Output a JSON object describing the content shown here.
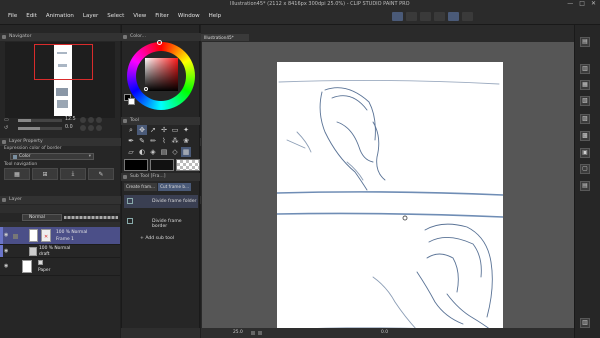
{
  "window": {
    "title": "Illustration45* (2112 x 8416px 300dpi 25.0%) - CLIP STUDIO PAINT PRO",
    "controls": [
      "—",
      "□",
      "✕"
    ]
  },
  "menu": [
    "File",
    "Edit",
    "Animation",
    "Layer",
    "Select",
    "View",
    "Filter",
    "Window",
    "Help"
  ],
  "navigator": {
    "title": "Navigator",
    "zoom_value": "12.5",
    "angle_value": "0.0"
  },
  "color_wheel": {
    "title": "Color...",
    "main_color": "#000000",
    "sub_color": "#ffffff"
  },
  "layer_property": {
    "title": "Layer Property",
    "expression_label": "Expression color of border",
    "expression_value": "Color",
    "tool_navigation_label": "Tool navigation"
  },
  "tool_panel": {
    "title": "Tool"
  },
  "sub_tool": {
    "title": "Sub Tool [Fra...]",
    "tabs": [
      "Create fram...",
      "Cut frame b..."
    ],
    "items": [
      "Divide frame folder",
      "Divide frame border"
    ],
    "add_label": "Add sub tool"
  },
  "layers": {
    "title": "Layer",
    "blend_mode": "Normal",
    "items": [
      {
        "mode": "100 % Normal",
        "name": "Frame 1",
        "selected": true
      },
      {
        "mode": "100 % Normal",
        "name": "draft",
        "selected": false
      },
      {
        "mode": "",
        "name": "Paper",
        "selected": false
      }
    ]
  },
  "document": {
    "tab_label": "Illustration45*",
    "status_zoom": "25.0",
    "status_rotate": "0.0"
  },
  "accent_colors": {
    "selection": "#4b4f88",
    "active_tool": "#4a5a78",
    "frame_red": "#d92c2c"
  }
}
